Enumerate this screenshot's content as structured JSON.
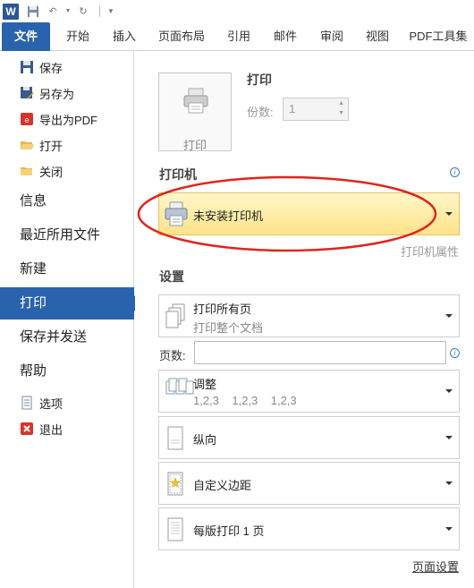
{
  "tabs": [
    "文件",
    "开始",
    "插入",
    "页面布局",
    "引用",
    "邮件",
    "审阅",
    "视图",
    "PDF工具集"
  ],
  "nav": {
    "small_top": [
      {
        "label": "保存",
        "icon": "save-icon"
      },
      {
        "label": "另存为",
        "icon": "save-as-icon"
      },
      {
        "label": "导出为PDF",
        "icon": "pdf-icon"
      },
      {
        "label": "打开",
        "icon": "open-folder-icon"
      },
      {
        "label": "关闭",
        "icon": "close-folder-icon"
      }
    ],
    "info": "信息",
    "recent": "最近所用文件",
    "new": "新建",
    "print": "打印",
    "save_send": "保存并发送",
    "help": "帮助",
    "options": "选项",
    "exit": "退出"
  },
  "print": {
    "button_label": "打印",
    "title": "打印",
    "copies_label": "份数:",
    "copies_value": "1"
  },
  "printer": {
    "section_title": "打印机",
    "selected": "未安装打印机",
    "properties_link": "打印机属性"
  },
  "settings": {
    "section_title": "设置",
    "pages_option_title": "打印所有页",
    "pages_option_desc": "打印整个文档",
    "pages_label": "页数:",
    "pages_value": "",
    "collate_title": "调整",
    "collate_desc": "1,2,3    1,2,3    1,2,3",
    "orientation": "纵向",
    "margins": "自定义边距",
    "pages_per_sheet": "每版打印 1 页",
    "page_setup_link": "页面设置"
  },
  "colors": {
    "accent": "#2a63ad",
    "printer_highlight": "#ffe38a",
    "annotation_red": "#e0241b"
  }
}
